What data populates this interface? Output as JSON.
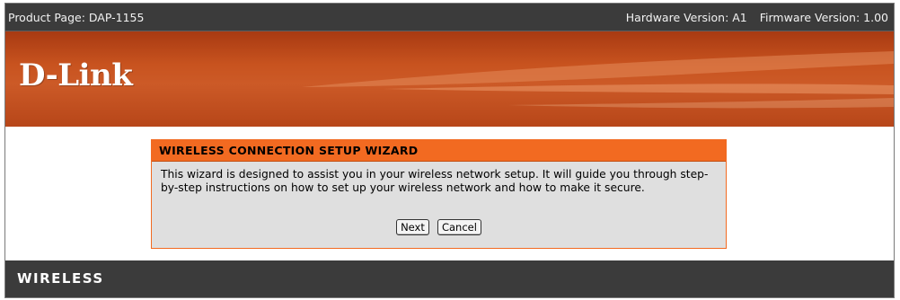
{
  "topbar": {
    "product_page": "Product Page: DAP-1155",
    "hardware_version": "Hardware Version: A1",
    "firmware_version": "Firmware Version: 1.00"
  },
  "banner": {
    "logo_text": "D-Link"
  },
  "wizard": {
    "title": "WIRELESS CONNECTION SETUP WIZARD",
    "description": "This wizard is designed to assist you in your wireless network setup. It will guide you through step-by-step instructions on how to set up your wireless network and how to make it secure.",
    "next_label": "Next",
    "cancel_label": "Cancel"
  },
  "footer": {
    "label": "WIRELESS"
  },
  "colors": {
    "accent": "#f26a21",
    "dark_bar": "#3b3b3b",
    "panel_bg": "#dfdfdf"
  }
}
